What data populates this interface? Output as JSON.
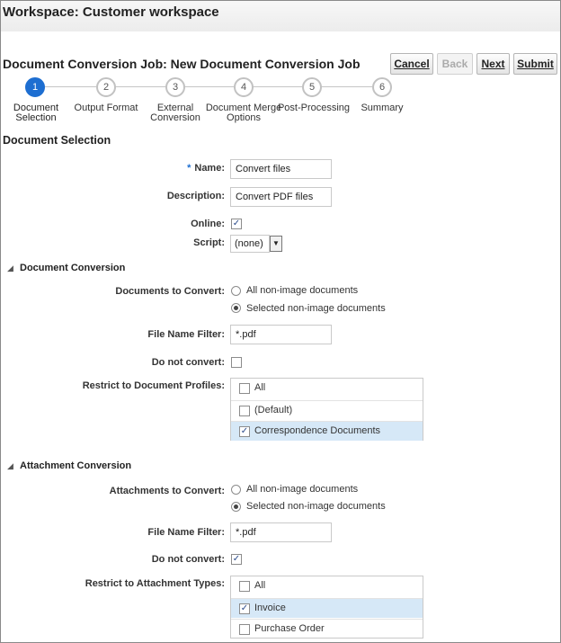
{
  "workspace": {
    "title": "Workspace: Customer workspace"
  },
  "job": {
    "title": "Document Conversion Job: New Document Conversion Job"
  },
  "buttons": {
    "cancel": "Cancel",
    "back": "Back",
    "next": "Next",
    "submit": "Submit"
  },
  "train": {
    "steps": [
      {
        "number": "1",
        "label_1": "Document",
        "label_2": "Selection",
        "active": true
      },
      {
        "number": "2",
        "label_1": "Output Format",
        "label_2": "",
        "active": false
      },
      {
        "number": "3",
        "label_1": "External",
        "label_2": "Conversion",
        "active": false
      },
      {
        "number": "4",
        "label_1": "Document Merge",
        "label_2": "Options",
        "active": false
      },
      {
        "number": "5",
        "label_1": "Post-Processing",
        "label_2": "",
        "active": false
      },
      {
        "number": "6",
        "label_1": "Summary",
        "label_2": "",
        "active": false
      }
    ]
  },
  "section": {
    "title": "Document Selection"
  },
  "form": {
    "name_required": "*",
    "name_label": "Name:",
    "name_value": "Convert files",
    "description_label": "Description:",
    "description_value": "Convert PDF files",
    "online_label": "Online:",
    "online_checked": true,
    "script_label": "Script:",
    "script_value": "(none)"
  },
  "doc_conversion": {
    "title": "Document Conversion",
    "docs_label": "Documents to Convert:",
    "option_all": "All non-image documents",
    "option_selected": "Selected non-image documents",
    "selected_option": "selected",
    "filter_label": "File Name Filter:",
    "filter_value": "*.pdf",
    "do_not_convert_label": "Do not convert:",
    "do_not_convert_checked": false,
    "profiles_label": "Restrict to Document Profiles:",
    "profiles": [
      {
        "label": "All",
        "checked": false,
        "selected": false
      },
      {
        "label": "(Default)",
        "checked": false,
        "selected": false
      },
      {
        "label": "Correspondence Documents",
        "checked": true,
        "selected": true
      }
    ]
  },
  "attachment_conversion": {
    "title": "Attachment Conversion",
    "attach_label": "Attachments to Convert:",
    "option_all": "All non-image documents",
    "option_selected": "Selected non-image documents",
    "selected_option": "selected",
    "filter_label": "File Name Filter:",
    "filter_value": "*.pdf",
    "do_not_convert_label": "Do not convert:",
    "do_not_convert_checked": true,
    "types_label": "Restrict to Attachment Types:",
    "types": [
      {
        "label": "All",
        "checked": false,
        "selected": false
      },
      {
        "label": "Invoice",
        "checked": true,
        "selected": true
      },
      {
        "label": "Purchase Order",
        "checked": false,
        "selected": false
      }
    ]
  },
  "colors": {
    "accent": "#1d6ed1",
    "selection": "#d6e8f7",
    "header_band": "#efefef"
  },
  "icons": {
    "check": "checkmark-glyph",
    "disclose": "triangle-down",
    "dropdown": "triangle-down"
  }
}
